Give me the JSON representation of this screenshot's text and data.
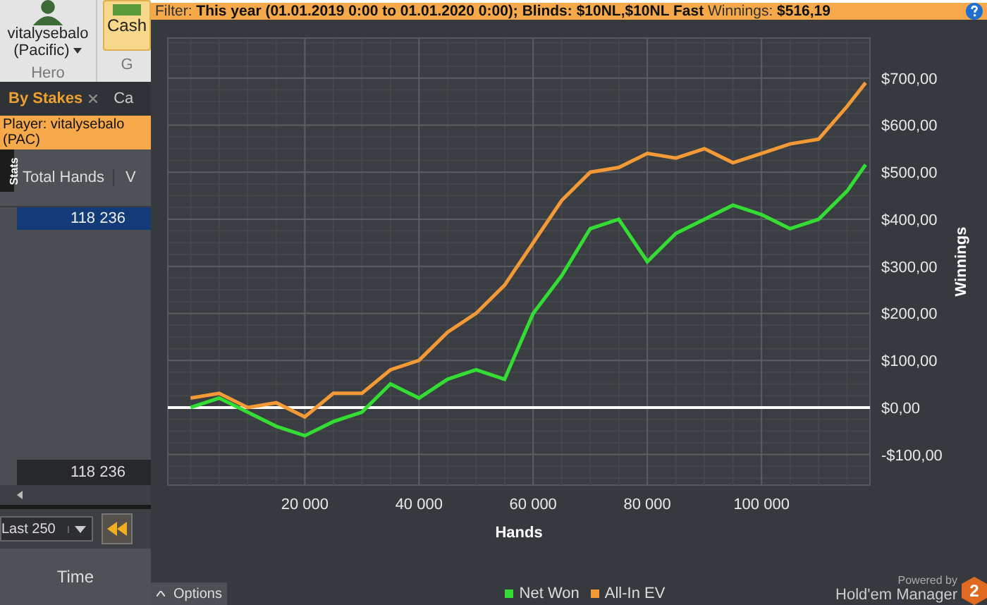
{
  "hero": {
    "name": "vitalysebalo",
    "site": "(Pacific)",
    "label": "Hero"
  },
  "ribbon": {
    "cash_button": "Cash",
    "group_label": "G"
  },
  "tabs": [
    {
      "label": "By Stakes",
      "selected": true,
      "closable": true
    },
    {
      "label": "Ca",
      "selected": false,
      "closable": false
    }
  ],
  "player_bar": "Player: vitalysebalo (PAC)",
  "stats_tab": "Stats",
  "table": {
    "columns": [
      "Total Hands",
      "V"
    ],
    "rows": [
      {
        "cells": [
          "118 236"
        ],
        "selected": true
      }
    ],
    "footer": [
      "118 236"
    ]
  },
  "toolbar": {
    "range": "Last 250"
  },
  "lower_table": {
    "columns": [
      "Time"
    ]
  },
  "graph_window": {
    "filter": "Filter: **This year (01.01.2019 0:00 to 01.01.2020 0:00); Blinds: $10NL,$10NL Fast** Winnings: **$516,19**",
    "chart_data": {
      "type": "line",
      "xlabel": "Hands",
      "ylabel": "Winnings",
      "x": [
        0,
        5000,
        10000,
        15000,
        20000,
        25000,
        30000,
        35000,
        40000,
        45000,
        50000,
        55000,
        60000,
        65000,
        70000,
        75000,
        80000,
        85000,
        90000,
        95000,
        100000,
        105000,
        110000,
        115000,
        118236
      ],
      "series": [
        {
          "name": "Net Won",
          "color": "#33dd33",
          "values": [
            0,
            20,
            -10,
            -40,
            -60,
            -30,
            -10,
            50,
            20,
            60,
            80,
            60,
            200,
            280,
            380,
            400,
            310,
            370,
            400,
            430,
            410,
            380,
            400,
            460,
            516
          ]
        },
        {
          "name": "All-In EV",
          "color": "#f39a37",
          "values": [
            20,
            30,
            0,
            10,
            -20,
            30,
            30,
            80,
            100,
            160,
            200,
            260,
            350,
            440,
            500,
            510,
            540,
            530,
            550,
            520,
            540,
            560,
            570,
            640,
            690
          ]
        }
      ],
      "xlim": [
        -4000,
        119000
      ],
      "ylim": [
        -165,
        785
      ],
      "xticks": [
        {
          "value": 20000,
          "label": "20 000"
        },
        {
          "value": 40000,
          "label": "40 000"
        },
        {
          "value": 60000,
          "label": "60 000"
        },
        {
          "value": 80000,
          "label": "80 000"
        },
        {
          "value": 100000,
          "label": "100 000"
        }
      ],
      "yticks": [
        {
          "value": -100,
          "label": "-$100,00"
        },
        {
          "value": 0,
          "label": "$0,00"
        },
        {
          "value": 100,
          "label": "$100,00"
        },
        {
          "value": 200,
          "label": "$200,00"
        },
        {
          "value": 300,
          "label": "$300,00"
        },
        {
          "value": 400,
          "label": "$400,00"
        },
        {
          "value": 500,
          "label": "$500,00"
        },
        {
          "value": 600,
          "label": "$600,00"
        },
        {
          "value": 700,
          "label": "$700,00"
        }
      ],
      "grid": true,
      "ref_lines": [
        {
          "axis": "y",
          "value": 0
        }
      ]
    },
    "options_button": "Options",
    "powered_by": "Powered by",
    "brand": "Hold'em Manager",
    "brand_badge": "2"
  }
}
